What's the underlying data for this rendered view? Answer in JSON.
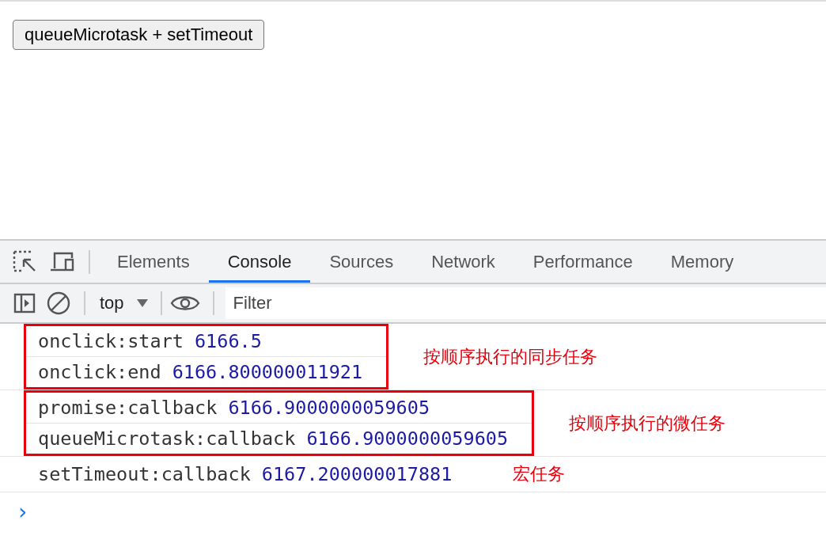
{
  "page": {
    "button": "queueMicrotask + setTimeout"
  },
  "devtools": {
    "tabs": [
      {
        "label": "Elements",
        "selected": false
      },
      {
        "label": "Console",
        "selected": true
      },
      {
        "label": "Sources",
        "selected": false
      },
      {
        "label": "Network",
        "selected": false
      },
      {
        "label": "Performance",
        "selected": false
      },
      {
        "label": "Memory",
        "selected": false
      }
    ],
    "toolbar": {
      "context": "top",
      "filter": {
        "placeholder": "Filter"
      }
    },
    "log_groups": [
      {
        "boxed": true,
        "annotation": "按顺序执行的同步任务",
        "rows": [
          {
            "message": "onclick:start",
            "value": "6166.5"
          },
          {
            "message": "onclick:end",
            "value": "6166.800000011921"
          }
        ]
      },
      {
        "boxed": true,
        "annotation": "按顺序执行的微任务",
        "rows": [
          {
            "message": "promise:callback",
            "value": "6166.9000000059605"
          },
          {
            "message": "queueMicrotask:callback",
            "value": "6166.9000000059605"
          }
        ]
      },
      {
        "boxed": false,
        "annotation": "宏任务",
        "rows": [
          {
            "message": "setTimeout:callback",
            "value": "6167.200000017881"
          }
        ]
      }
    ],
    "prompt": "›"
  }
}
